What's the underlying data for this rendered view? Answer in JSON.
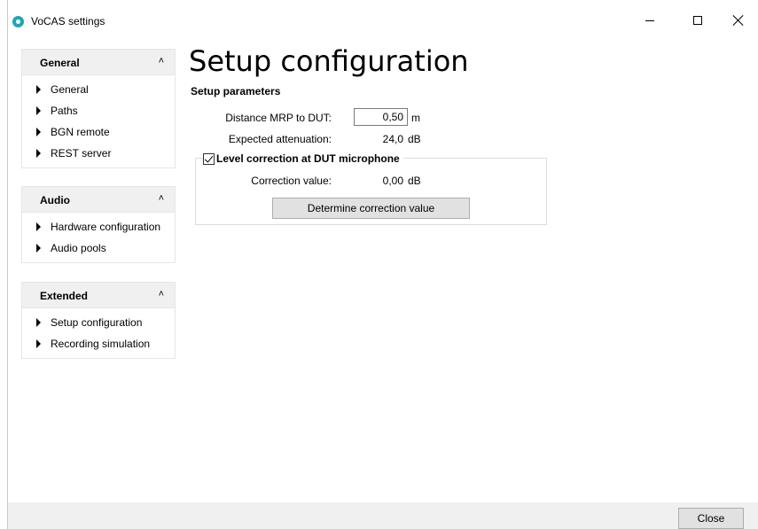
{
  "window": {
    "title": "VoCAS settings"
  },
  "sidebar": {
    "sections": [
      {
        "title": "General",
        "collapse_icon": "chevrons-up-icon",
        "items": [
          "General",
          "Paths",
          "BGN remote",
          "REST server"
        ]
      },
      {
        "title": "Audio",
        "collapse_icon": "chevrons-up-icon",
        "items": [
          "Hardware configuration",
          "Audio pools"
        ]
      },
      {
        "title": "Extended",
        "collapse_icon": "chevrons-up-icon",
        "items": [
          "Setup configuration",
          "Recording simulation"
        ]
      }
    ]
  },
  "main": {
    "page_title": "Setup configuration",
    "setup_parameters": {
      "heading": "Setup parameters",
      "distance_label": "Distance MRP to DUT:",
      "distance_value": "0,50",
      "distance_unit": "m",
      "attenuation_label": "Expected attenuation:",
      "attenuation_value": "24,0",
      "attenuation_unit": "dB"
    },
    "level_correction": {
      "label": "Level correction at DUT microphone",
      "checked": true,
      "correction_label": "Correction value:",
      "correction_value": "0,00",
      "correction_unit": "dB",
      "determine_button": "Determine correction value"
    }
  },
  "footer": {
    "close_button": "Close"
  },
  "colors": {
    "accent": "#1fa5b8",
    "header_bg": "#f0f0f0",
    "button_bg": "#e1e1e1"
  }
}
